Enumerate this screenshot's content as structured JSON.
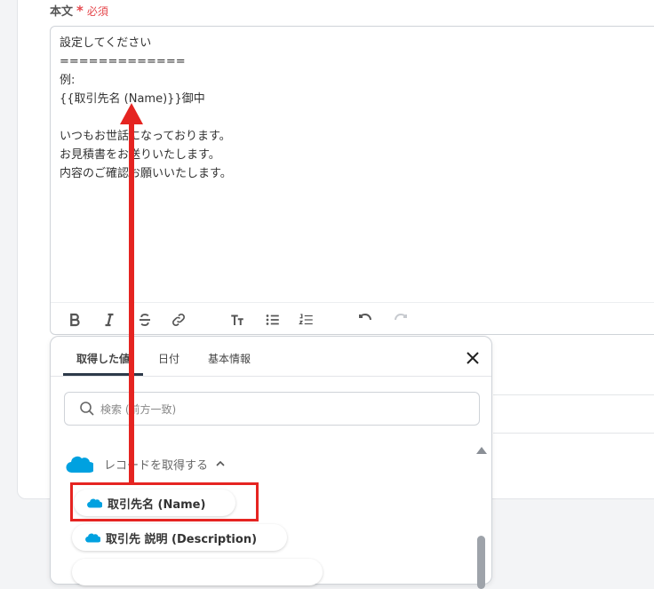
{
  "field": {
    "label": "本文",
    "required_mark": "*",
    "required_text": "必須"
  },
  "editor": {
    "content": "設定してください\n=============\n例:\n{{取引先名 (Name)}}御中\n\nいつもお世話になっております。\nお見積書をお送りいたします。\n内容のご確認お願いいたします。"
  },
  "toolbar": {
    "icons": [
      "bold-icon",
      "italic-icon",
      "strikethrough-icon",
      "link-icon",
      "text-size-icon",
      "bullet-list-icon",
      "numbered-list-icon",
      "undo-icon",
      "redo-icon"
    ]
  },
  "popup": {
    "tabs": [
      {
        "label": "取得した値",
        "active": true
      },
      {
        "label": "日付",
        "active": false
      },
      {
        "label": "基本情報",
        "active": false
      }
    ],
    "search": {
      "placeholder": "検索 (前方一致)",
      "value": ""
    },
    "section": {
      "label": "レコードを取得する"
    },
    "items": [
      {
        "label": "取引先名 (Name)"
      },
      {
        "label": "取引先 説明 (Description)"
      }
    ]
  },
  "colors": {
    "accent_dark": "#2e3a4a",
    "required": "#e5484d",
    "salesforce_blue": "#00a1e0",
    "annotation_red": "#e52421"
  }
}
